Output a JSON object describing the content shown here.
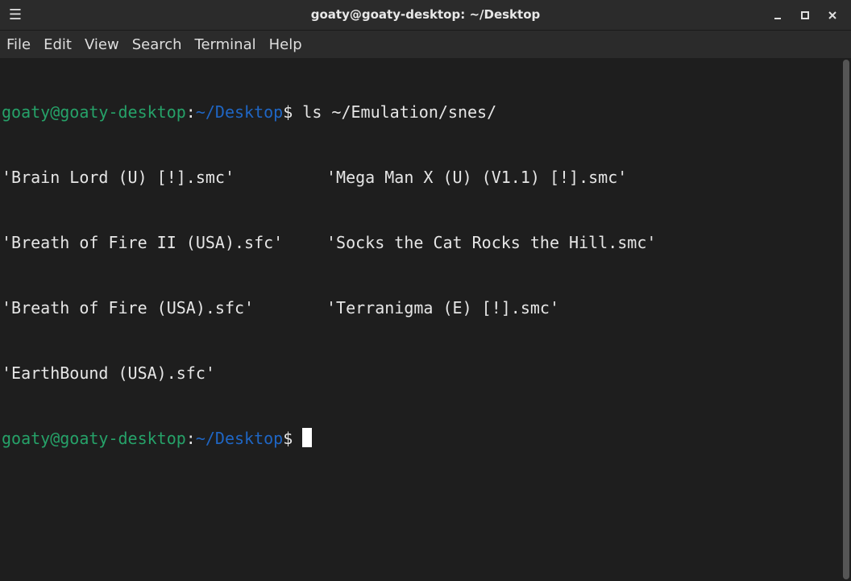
{
  "window": {
    "title": "goaty@goaty-desktop: ~/Desktop"
  },
  "icons": {
    "menu": "hamburger-icon",
    "minimize": "minimize-icon",
    "maximize": "maximize-icon",
    "close": "close-icon"
  },
  "menubar": {
    "items": [
      "File",
      "Edit",
      "View",
      "Search",
      "Terminal",
      "Help"
    ]
  },
  "colors": {
    "prompt_user": "#26a269",
    "prompt_path": "#1f66c4",
    "background": "#1e1e1e"
  },
  "terminal": {
    "prompt1": {
      "user": "goaty@goaty-desktop",
      "colon": ":",
      "path": "~/Desktop",
      "dollar": "$",
      "command": " ls ~/Emulation/snes/"
    },
    "listing": [
      [
        "'Brain Lord (U) [!].smc'",
        "'Mega Man X (U) (V1.1) [!].smc'"
      ],
      [
        "'Breath of Fire II (USA).sfc'",
        "'Socks the Cat Rocks the Hill.smc'"
      ],
      [
        "'Breath of Fire (USA).sfc'",
        "'Terranigma (E) [!].smc'"
      ],
      [
        "'EarthBound (USA).sfc'",
        ""
      ]
    ],
    "prompt2": {
      "user": "goaty@goaty-desktop",
      "colon": ":",
      "path": "~/Desktop",
      "dollar": "$",
      "command": " "
    }
  }
}
